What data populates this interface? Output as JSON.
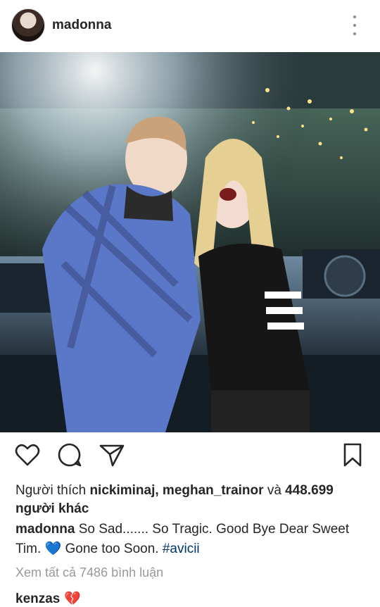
{
  "post": {
    "username": "madonna",
    "likes": {
      "prefix": "Người thích",
      "users": "nickiminaj, meghan_trainor",
      "conj": "và",
      "count": "448.699",
      "suffix": "người khác"
    },
    "caption": {
      "user": "madonna",
      "text_before": "So Sad....... So Tragic. Good Bye Dear Sweet Tim.",
      "emoji": "💙",
      "text_after": "Gone too Soon.",
      "hashtag": "#avicii"
    },
    "view_comments": "Xem tất cả 7486 bình luận",
    "first_comment": {
      "user": "kenzas",
      "emoji": "💔"
    }
  },
  "icons": [
    "more-options-icon",
    "like-heart-icon",
    "comment-icon",
    "share-icon",
    "bookmark-icon"
  ],
  "colors": {
    "text": "#262626",
    "muted": "#999999",
    "hashtag": "#003569",
    "blue_heart": "#3bb7e8"
  }
}
